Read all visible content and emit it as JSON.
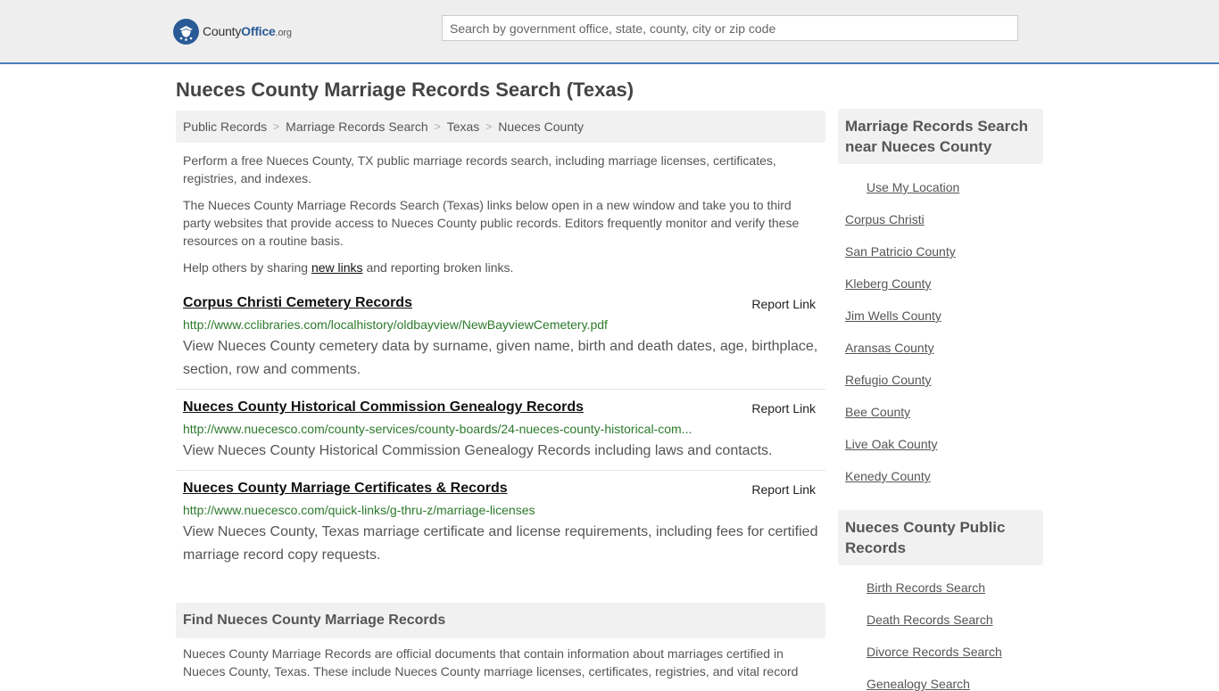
{
  "header": {
    "logo_county": "County",
    "logo_office": "Office",
    "logo_org": ".org",
    "search_placeholder": "Search by government office, state, county, city or zip code"
  },
  "page_title": "Nueces County Marriage Records Search (Texas)",
  "breadcrumb": [
    "Public Records",
    "Marriage Records Search",
    "Texas",
    "Nueces County"
  ],
  "intro": {
    "p1": "Perform a free Nueces County, TX public marriage records search, including marriage licenses, certificates, registries, and indexes.",
    "p2": "The Nueces County Marriage Records Search (Texas) links below open in a new window and take you to third party websites that provide access to Nueces County public records. Editors frequently monitor and verify these resources on a routine basis.",
    "p3_before": "Help others by sharing ",
    "p3_link": "new links",
    "p3_after": " and reporting broken links."
  },
  "results": [
    {
      "title": "Corpus Christi Cemetery Records",
      "report": "Report Link",
      "url": "http://www.cclibraries.com/localhistory/oldbayview/NewBayviewCemetery.pdf",
      "desc": "View Nueces County cemetery data by surname, given name, birth and death dates, age, birthplace, section, row and comments."
    },
    {
      "title": "Nueces County Historical Commission Genealogy Records",
      "report": "Report Link",
      "url": "http://www.nuecesco.com/county-services/county-boards/24-nueces-county-historical-com...",
      "desc": "View Nueces County Historical Commission Genealogy Records including laws and contacts."
    },
    {
      "title": "Nueces County Marriage Certificates & Records",
      "report": "Report Link",
      "url": "http://www.nuecesco.com/quick-links/g-thru-z/marriage-licenses",
      "desc": "View Nueces County, Texas marriage certificate and license requirements, including fees for certified marriage record copy requests."
    }
  ],
  "find": {
    "heading": "Find Nueces County Marriage Records",
    "text": "Nueces County Marriage Records are official documents that contain information about marriages certified in Nueces County, Texas. These include Nueces County marriage licenses, certificates, registries, and vital record"
  },
  "sidebar": {
    "nearby_heading": "Marriage Records Search near Nueces County",
    "use_location": "Use My Location",
    "nearby": [
      "Corpus Christi",
      "San Patricio County",
      "Kleberg County",
      "Jim Wells County",
      "Aransas County",
      "Refugio County",
      "Bee County",
      "Live Oak County",
      "Kenedy County"
    ],
    "public_heading": "Nueces County Public Records",
    "public": [
      "Birth Records Search",
      "Death Records Search",
      "Divorce Records Search",
      "Genealogy Search"
    ]
  }
}
